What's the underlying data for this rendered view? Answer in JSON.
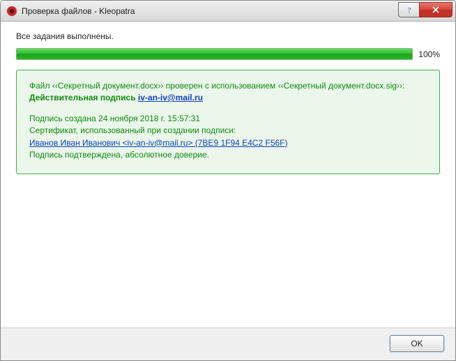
{
  "titlebar": {
    "title": "Проверка файлов - Kleopatra"
  },
  "status": {
    "label": "Все задания выполнены.",
    "percent": "100%"
  },
  "result": {
    "file_line": "Файл ‹‹Секретный документ.docx›› проверен с использованием ‹‹Секретный документ.docx.sig››:",
    "valid_prefix": "Действительная подпись ",
    "valid_email": "iv-an-iv@mail.ru",
    "created_line": "Подпись создана 24 ноября 2018 г. 15:57:31",
    "cert_label": "Сертификат, использованный при создании подписи:",
    "cert_link": "Иванов Иван Иванович <iv-an-iv@mail.ru> (7BE9 1F94 E4C2 F56F)",
    "trust_line": "Подпись подтверждена, абсолютное доверие."
  },
  "footer": {
    "ok_label": "OK"
  }
}
